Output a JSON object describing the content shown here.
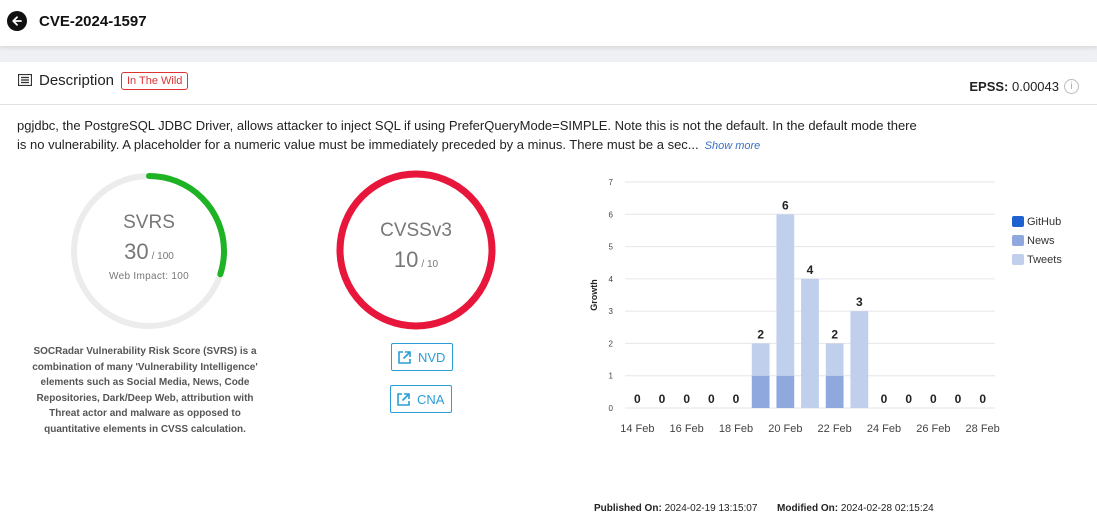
{
  "header": {
    "title": "CVE-2024-1597"
  },
  "description_card": {
    "title": "Description",
    "badge": "In The Wild",
    "epss_label": "EPSS:",
    "epss_value": "0.00043",
    "info_glyph": "i",
    "text": "pgjdbc, the PostgreSQL JDBC Driver, allows attacker to inject SQL if using PreferQueryMode=SIMPLE. Note this is not the default. In the default mode there is no vulnerability. A placeholder for a numeric value must be immediately preceded by a minus. There must be a sec...",
    "show_more": "Show more"
  },
  "svrs": {
    "title": "SVRS",
    "score": "30",
    "max": "/ 100",
    "score_fraction": 0.3,
    "impact_label": "Web Impact: 100",
    "color": "#1db325",
    "description": "SOCRadar Vulnerability Risk Score (SVRS) is a combination of many 'Vulnerability Intelligence' elements such as Social Media, News, Code Repositories, Dark/Deep Web, attribution with Threat actor and malware as opposed to quantitative elements in CVSS calculation."
  },
  "cvss": {
    "title": "CVSSv3",
    "score": "10",
    "max": "/ 10",
    "score_fraction": 1.0,
    "color": "#e8163a"
  },
  "links": {
    "nvd": "NVD",
    "cna": "CNA",
    "icon": "external-link-icon"
  },
  "chart_data": {
    "type": "bar",
    "stacked": true,
    "categories": [
      "14 Feb",
      "15 Feb",
      "16 Feb",
      "17 Feb",
      "18 Feb",
      "19 Feb",
      "20 Feb",
      "21 Feb",
      "22 Feb",
      "23 Feb",
      "24 Feb",
      "25 Feb",
      "26 Feb",
      "27 Feb",
      "28 Feb"
    ],
    "x_tick_labels": [
      "14 Feb",
      "16 Feb",
      "18 Feb",
      "20 Feb",
      "22 Feb",
      "24 Feb",
      "26 Feb",
      "28 Feb"
    ],
    "series": [
      {
        "name": "GitHub",
        "color": "#1e62d0",
        "values": [
          0,
          0,
          0,
          0,
          0,
          0,
          0,
          0,
          0,
          0,
          0,
          0,
          0,
          0,
          0
        ]
      },
      {
        "name": "News",
        "color": "#8fa9df",
        "values": [
          0,
          0,
          0,
          0,
          0,
          1,
          1,
          0,
          1,
          0,
          0,
          0,
          0,
          0,
          0
        ]
      },
      {
        "name": "Tweets",
        "color": "#c0cfec",
        "values": [
          0,
          0,
          0,
          0,
          0,
          1,
          5,
          4,
          1,
          3,
          0,
          0,
          0,
          0,
          0
        ]
      }
    ],
    "totals": [
      0,
      0,
      0,
      0,
      0,
      2,
      6,
      4,
      2,
      3,
      0,
      0,
      0,
      0,
      0
    ],
    "ylabel": "Growth",
    "xlabel": "",
    "ylim": [
      0,
      7
    ],
    "yticks": [
      0,
      1,
      2,
      3,
      4,
      5,
      6,
      7
    ],
    "grid": true,
    "legend": "right"
  },
  "footer": {
    "published_label": "Published On:",
    "published_value": "2024-02-19 13:15:07",
    "modified_label": "Modified On:",
    "modified_value": "2024-02-28 02:15:24"
  }
}
